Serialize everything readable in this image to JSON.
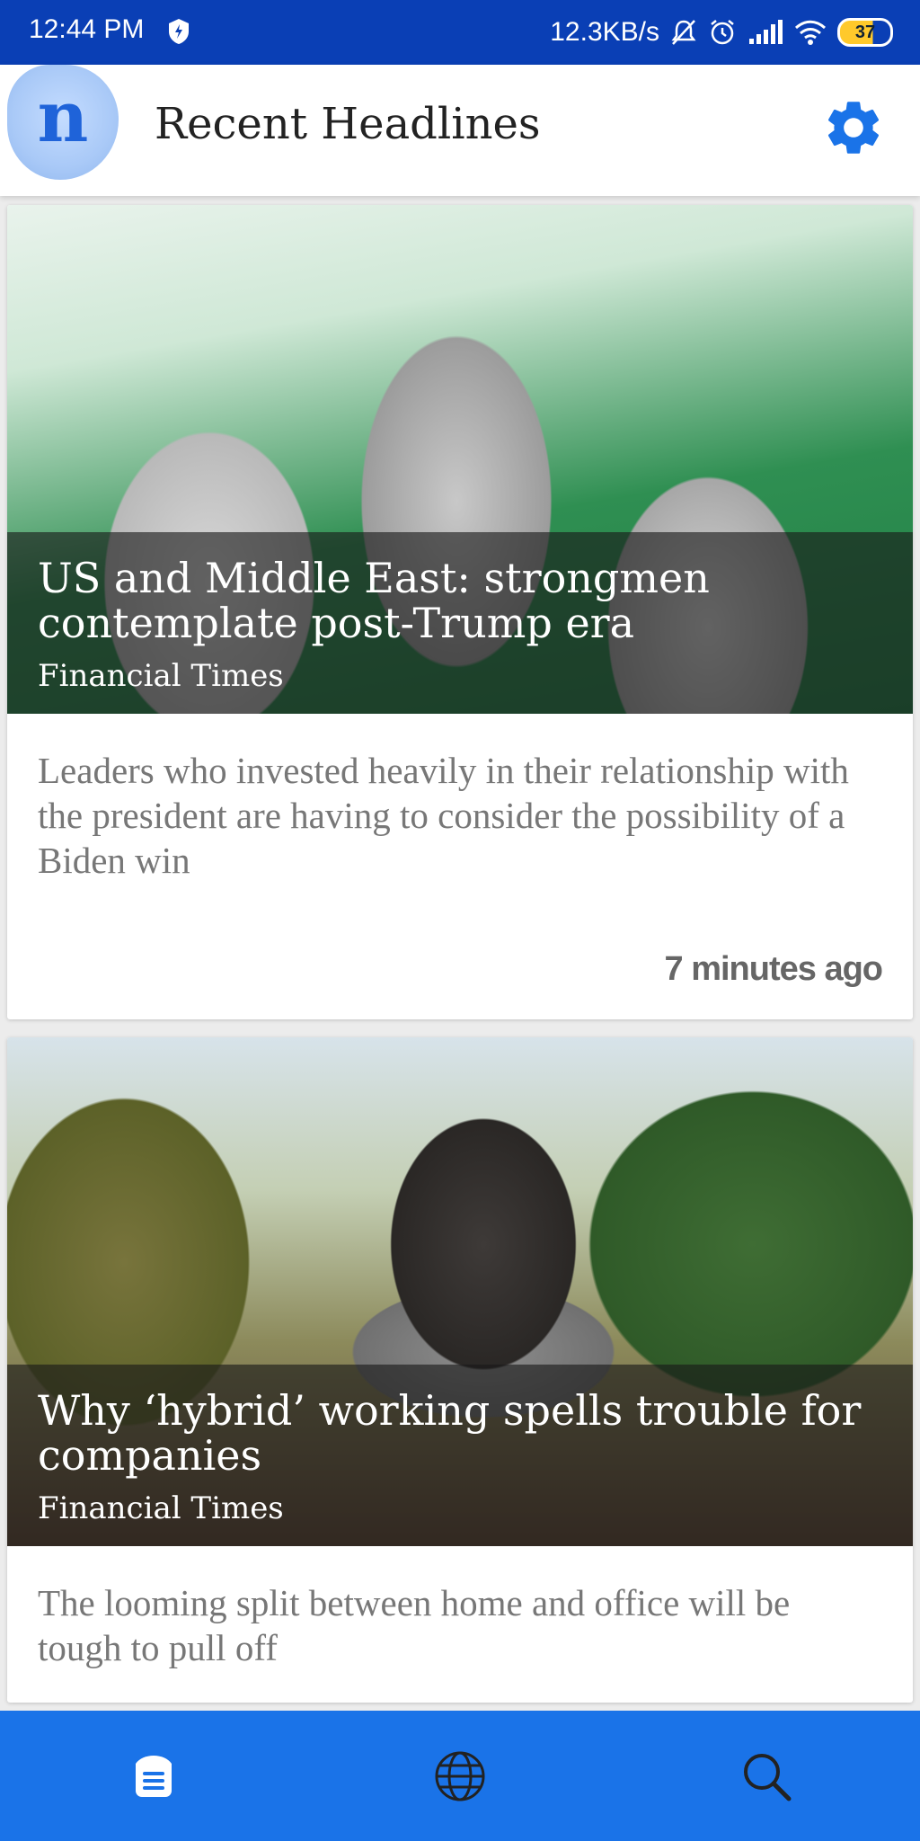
{
  "status_bar": {
    "time": "12:44 PM",
    "network_speed": "12.3KB/s",
    "battery": "37"
  },
  "app_bar": {
    "logo_letter": "n",
    "title": "Recent Headlines"
  },
  "articles": [
    {
      "headline": "US and Middle East: strongmen contemplate post-Trump era",
      "source": "Financial Times",
      "summary": "Leaders who invested heavily in their relationship with the president are having to consider the possibility of a Biden win",
      "time_ago": "7 minutes ago"
    },
    {
      "headline": "Why ‘hybrid’ working spells trouble for companies",
      "source": "Financial Times",
      "summary": "The looming split between home and office will be tough to pull off"
    }
  ],
  "bottom_nav": {
    "items": [
      "headlines-icon",
      "globe-icon",
      "search-icon"
    ]
  },
  "colors": {
    "status_bar": "#0a3fb5",
    "accent": "#1a73e8",
    "gear": "#1a73e8"
  }
}
